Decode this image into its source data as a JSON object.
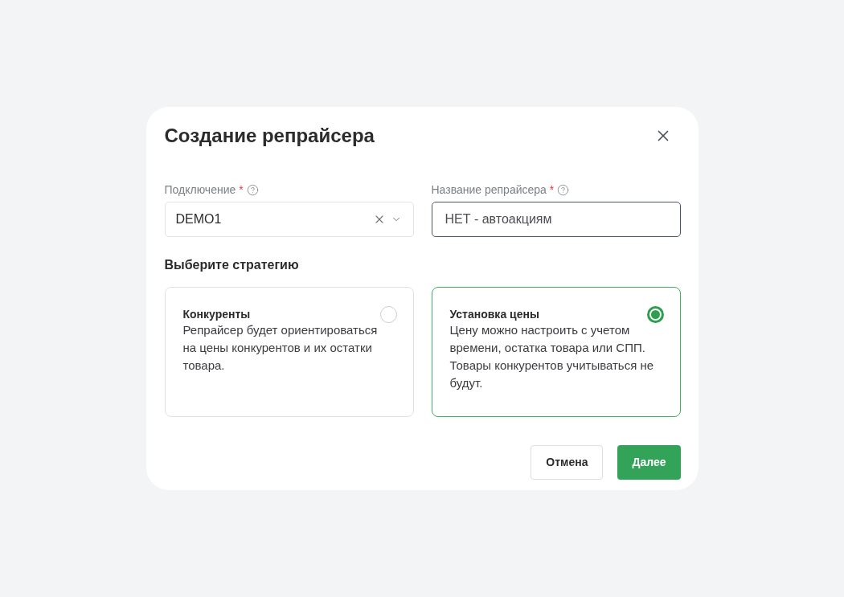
{
  "dialog": {
    "title": "Создание репрайсера",
    "fields": [
      {
        "kind": "select",
        "label": "Подключение",
        "required_mark": "*",
        "value": "DEMO1",
        "focused": false
      },
      {
        "kind": "text",
        "label": "Название репрайсера",
        "required_mark": "*",
        "value": "НЕТ - автоакциям",
        "focused": true
      }
    ],
    "strategy": {
      "heading": "Выберите стратегию",
      "options": [
        {
          "title": "Конкуренты",
          "description": "Репрайсер будет ориентироваться на цены конкурентов и их остатки товара.",
          "selected": false
        },
        {
          "title": "Установка цены",
          "description": "Цену можно настроить с учетом времени, остатка товара или СПП. Товары конкурентов учитываться не будут.",
          "selected": true
        }
      ]
    },
    "buttons": [
      {
        "kind": "secondary",
        "label": "Отмена"
      },
      {
        "kind": "primary",
        "label": "Далее"
      }
    ]
  }
}
